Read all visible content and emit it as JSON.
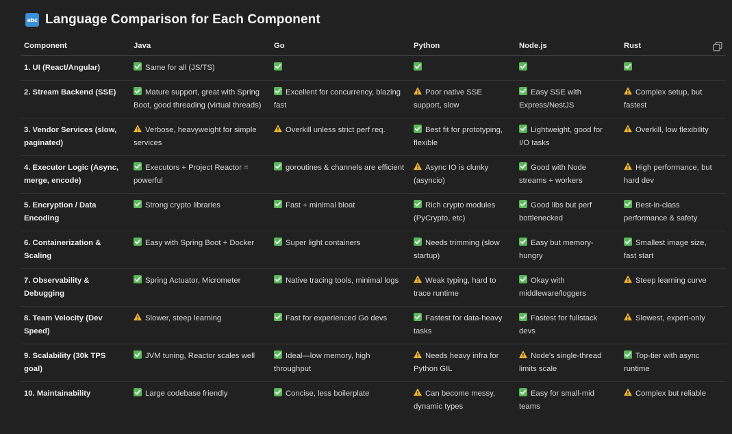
{
  "title": "Language Comparison for Each Component",
  "heading_icon": "abc",
  "columns": [
    "Component",
    "Java",
    "Go",
    "Python",
    "Node.js",
    "Rust"
  ],
  "rows": [
    {
      "component": "1. UI (React/Angular)",
      "cells": [
        {
          "status": "check",
          "text": "Same for all (JS/TS)"
        },
        {
          "status": "check",
          "text": ""
        },
        {
          "status": "check",
          "text": ""
        },
        {
          "status": "check",
          "text": ""
        },
        {
          "status": "check",
          "text": ""
        }
      ]
    },
    {
      "component": "2. Stream Backend (SSE)",
      "cells": [
        {
          "status": "check",
          "text": "Mature support, great with Spring Boot, good threading (virtual threads)"
        },
        {
          "status": "check",
          "text": "Excellent for concurrency, blazing fast"
        },
        {
          "status": "warning",
          "text": "Poor native SSE support, slow"
        },
        {
          "status": "check",
          "text": "Easy SSE with Express/NestJS"
        },
        {
          "status": "warning",
          "text": "Complex setup, but fastest"
        }
      ]
    },
    {
      "component": "3. Vendor Services (slow, paginated)",
      "cells": [
        {
          "status": "warning",
          "text": "Verbose, heavyweight for simple services"
        },
        {
          "status": "warning",
          "text": "Overkill unless strict perf req."
        },
        {
          "status": "check",
          "text": "Best fit for prototyping, flexible"
        },
        {
          "status": "check",
          "text": "Lightweight, good for I/O tasks"
        },
        {
          "status": "warning",
          "text": "Overkill, low flexibility"
        }
      ]
    },
    {
      "component": "4. Executor Logic (Async, merge, encode)",
      "cells": [
        {
          "status": "check",
          "text": "Executors + Project Reactor = powerful"
        },
        {
          "status": "check",
          "text": "goroutines & channels are efficient"
        },
        {
          "status": "warning",
          "text": "Async IO is clunky (asyncio)"
        },
        {
          "status": "check",
          "text": "Good with Node streams + workers"
        },
        {
          "status": "warning",
          "text": "High performance, but hard dev"
        }
      ]
    },
    {
      "component": "5. Encryption / Data Encoding",
      "cells": [
        {
          "status": "check",
          "text": "Strong crypto libraries"
        },
        {
          "status": "check",
          "text": "Fast + minimal bloat"
        },
        {
          "status": "check",
          "text": "Rich crypto modules (PyCrypto, etc)"
        },
        {
          "status": "check",
          "text": "Good libs but perf bottlenecked"
        },
        {
          "status": "check",
          "text": "Best-in-class performance & safety"
        }
      ]
    },
    {
      "component": "6. Containerization & Scaling",
      "cells": [
        {
          "status": "check",
          "text": "Easy with Spring Boot + Docker"
        },
        {
          "status": "check",
          "text": "Super light containers"
        },
        {
          "status": "check",
          "text": "Needs trimming (slow startup)"
        },
        {
          "status": "check",
          "text": "Easy but memory-hungry"
        },
        {
          "status": "check",
          "text": "Smallest image size, fast start"
        }
      ]
    },
    {
      "component": "7. Observability & Debugging",
      "cells": [
        {
          "status": "check",
          "text": "Spring Actuator, Micrometer"
        },
        {
          "status": "check",
          "text": "Native tracing tools, minimal logs"
        },
        {
          "status": "warning",
          "text": "Weak typing, hard to trace runtime"
        },
        {
          "status": "check",
          "text": "Okay with middleware/loggers"
        },
        {
          "status": "warning",
          "text": "Steep learning curve"
        }
      ]
    },
    {
      "component": "8. Team Velocity (Dev Speed)",
      "cells": [
        {
          "status": "warning",
          "text": "Slower, steep learning"
        },
        {
          "status": "check",
          "text": "Fast for experienced Go devs"
        },
        {
          "status": "check",
          "text": "Fastest for data-heavy tasks"
        },
        {
          "status": "check",
          "text": "Fastest for fullstack devs"
        },
        {
          "status": "warning",
          "text": "Slowest, expert-only"
        }
      ]
    },
    {
      "component": "9. Scalability (30k TPS goal)",
      "cells": [
        {
          "status": "check",
          "text": "JVM tuning, Reactor scales well"
        },
        {
          "status": "check",
          "text": "Ideal—low memory, high throughput"
        },
        {
          "status": "warning",
          "text": "Needs heavy infra for Python GIL"
        },
        {
          "status": "warning",
          "text": "Node's single-thread limits scale"
        },
        {
          "status": "check",
          "text": "Top-tier with async runtime"
        }
      ]
    },
    {
      "component": "10. Maintainability",
      "cells": [
        {
          "status": "check",
          "text": "Large codebase friendly"
        },
        {
          "status": "check",
          "text": "Concise, less boilerplate"
        },
        {
          "status": "warning",
          "text": "Can become messy, dynamic types"
        },
        {
          "status": "check",
          "text": "Easy for small-mid teams"
        },
        {
          "status": "warning",
          "text": "Complex but reliable"
        }
      ]
    }
  ],
  "icons": {
    "check": "check-mark-button-icon",
    "warning": "warning-sign-icon",
    "copy": "copy-icon"
  },
  "colors": {
    "background": "#212121",
    "text": "#ececec",
    "check_green": "#5cb85c",
    "warning_amber": "#f2b632",
    "abc_blue": "#3d8fd6"
  }
}
